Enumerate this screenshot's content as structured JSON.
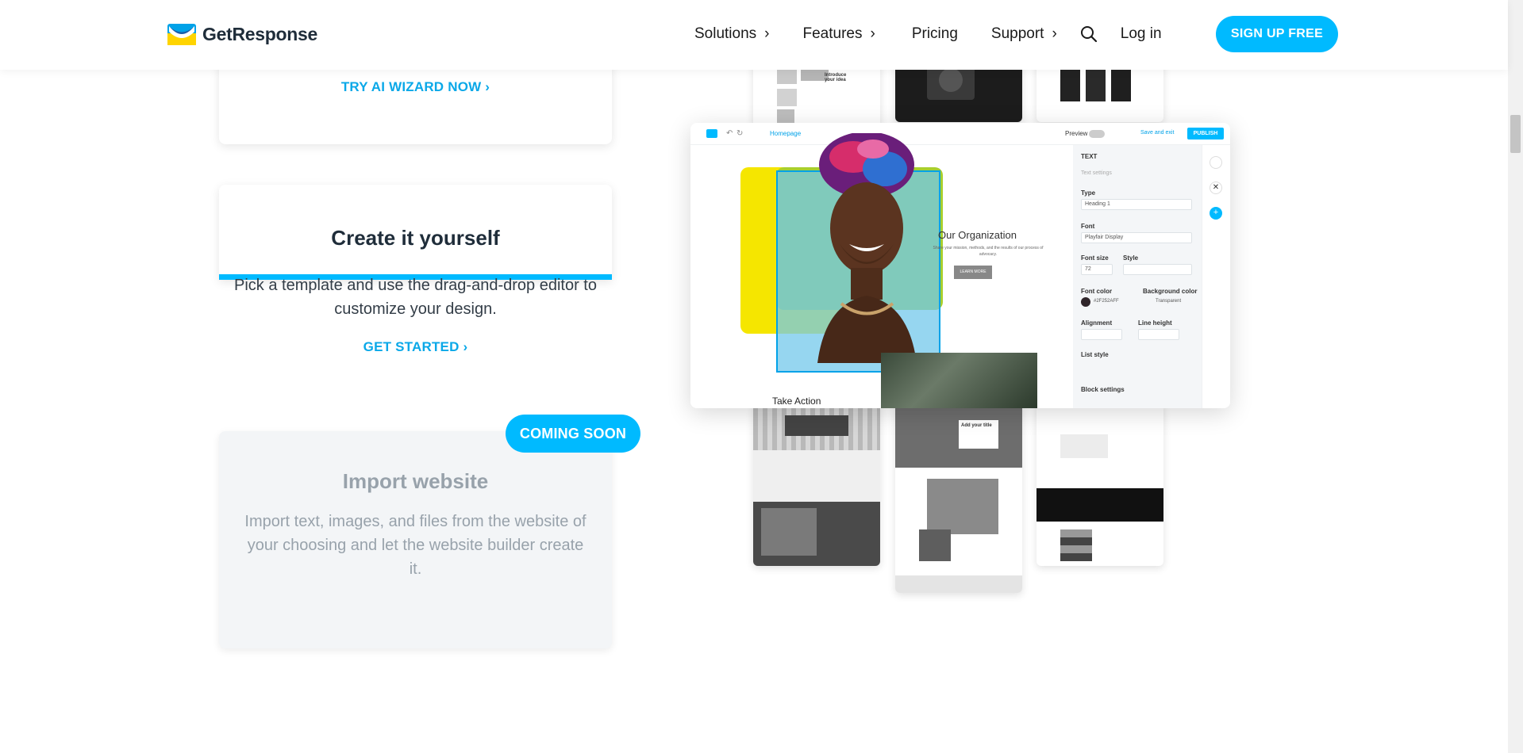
{
  "header": {
    "logo_text": "GetResponse",
    "nav": {
      "solutions": "Solutions",
      "features": "Features",
      "pricing": "Pricing",
      "support": "Support",
      "chevron": "›"
    },
    "login": "Log in",
    "signup": "SIGN UP FREE"
  },
  "cards": {
    "ai": {
      "link": "TRY AI WIZARD NOW ›"
    },
    "create": {
      "title": "Create it yourself",
      "desc": "Pick a template and use the drag-and-drop editor to customize your design.",
      "link": "GET STARTED ›"
    },
    "import": {
      "badge": "COMING SOON",
      "title": "Import website",
      "desc": "Import text, images, and files from the website of your choosing and let the website builder create it."
    }
  },
  "editor": {
    "page_select": "Homepage",
    "preview": "Preview",
    "save_exit": "Save and exit",
    "publish": "PUBLISH",
    "canvas_heading": "Our Organization",
    "canvas_body": "Share your mission, methods, and the results of our process of advocacy.",
    "canvas_button": "LEARN MORE",
    "take_action": "Take Action",
    "panel": {
      "section": "TEXT",
      "text_settings": "Text settings",
      "type_label": "Type",
      "type_value": "Heading 1",
      "font_label": "Font",
      "font_value": "Playfair Display",
      "size_label": "Font size",
      "size_value": "72",
      "style_label": "Style",
      "font_color_label": "Font color",
      "font_color_value": "#2F252AFF",
      "bg_color_label": "Background color",
      "bg_color_value": "Transparent",
      "alignment_label": "Alignment",
      "line_height_label": "Line height",
      "list_style_label": "List style",
      "block_settings": "Block settings"
    },
    "thumbs": {
      "intro": "Introduce your idea",
      "add_title": "Add your title",
      "add_title_2": "Add your title"
    }
  },
  "colors": {
    "accent": "#00baff",
    "link": "#0aa8e8",
    "yellow": "#f5e600",
    "lime": "#a8cf2e"
  }
}
